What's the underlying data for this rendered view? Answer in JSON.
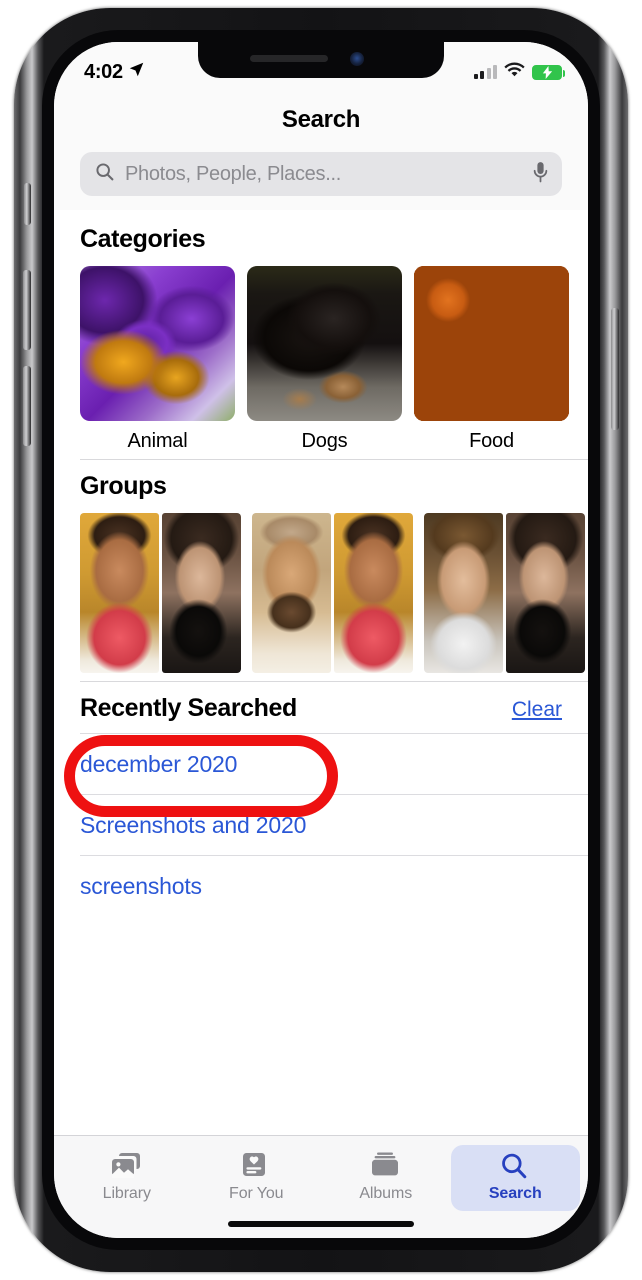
{
  "device": {
    "name": "iphone-x",
    "bezel_color": "#131315",
    "side_buttons": [
      "mute-switch",
      "volume-up",
      "volume-down",
      "power-button"
    ]
  },
  "status_bar": {
    "time": "4:02",
    "location_icon": "location-arrow-icon",
    "cellular_icon": "cellular-bars-icon",
    "cellular_bars_filled": 2,
    "cellular_bars_total": 4,
    "wifi_icon": "wifi-icon",
    "battery_icon": "battery-charging-icon",
    "battery_color": "#31c44b"
  },
  "nav": {
    "title": "Search"
  },
  "search": {
    "placeholder": "Photos, People, Places...",
    "value": "",
    "search_icon": "search-icon",
    "mic_icon": "microphone-icon",
    "field_bg": "#e4e4e7"
  },
  "categories": {
    "title": "Categories",
    "items": [
      {
        "label": "Animal",
        "art": "art-bee"
      },
      {
        "label": "Dogs",
        "art": "art-dog"
      },
      {
        "label": "Food",
        "art": "art-pumpkin"
      }
    ]
  },
  "groups": {
    "title": "Groups",
    "items": [
      {
        "faces": [
          "face-toddler",
          "face-woman"
        ]
      },
      {
        "faces": [
          "face-man",
          "face-toddler"
        ]
      },
      {
        "faces": [
          "face-boy",
          "face-woman"
        ]
      },
      {
        "faces": [
          "face-partial"
        ]
      }
    ]
  },
  "recently_searched": {
    "title": "Recently Searched",
    "clear_label": "Clear",
    "link_color": "#2a57d6",
    "items": [
      {
        "label": "december 2020",
        "highlighted": true
      },
      {
        "label": "Screenshots and 2020",
        "highlighted": false
      },
      {
        "label": "screenshots",
        "highlighted": false
      }
    ]
  },
  "annotation": {
    "shape": "red-oval-highlight",
    "color": "#ee1111",
    "targets": "december 2020"
  },
  "tab_bar": {
    "active": "Search",
    "active_bg": "#d9dff5",
    "active_color": "#2740bf",
    "items": [
      {
        "label": "Library",
        "icon": "photos-library-icon",
        "active": false
      },
      {
        "label": "For You",
        "icon": "for-you-card-icon",
        "active": false
      },
      {
        "label": "Albums",
        "icon": "albums-stack-icon",
        "active": false
      },
      {
        "label": "Search",
        "icon": "search-icon",
        "active": true
      }
    ]
  }
}
